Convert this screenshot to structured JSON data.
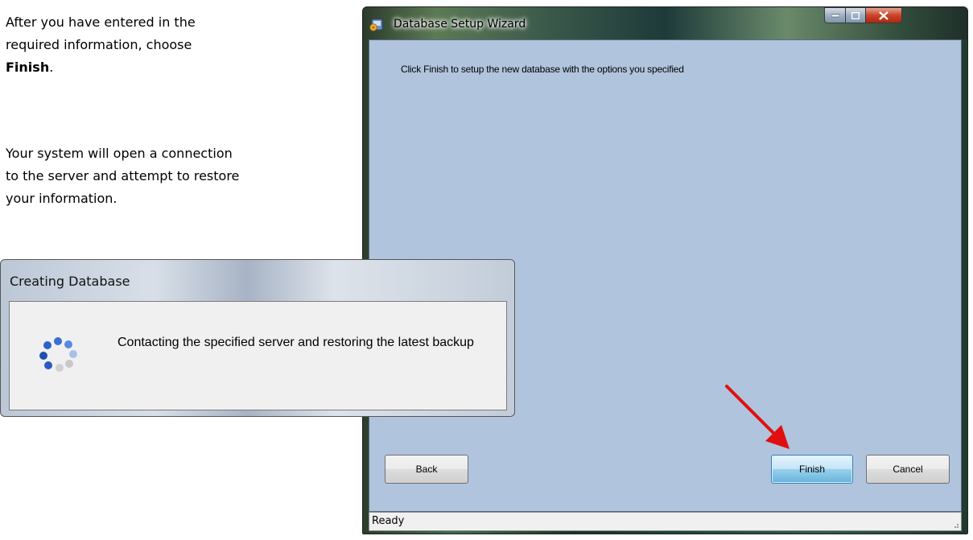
{
  "document": {
    "para1_prefix": "After you have entered in the required information, choose ",
    "para1_bold": "Finish",
    "para1_suffix": ".",
    "para2": "Your system will open a connection to the server and attempt to restore your information."
  },
  "wizard": {
    "title": "Database Setup Wizard",
    "icon": "wizard-gear-icon",
    "message": "Click Finish to setup the new database with the options you specified",
    "buttons": {
      "back": "Back",
      "finish": "Finish",
      "cancel": "Cancel"
    },
    "status": "Ready",
    "caption_buttons": {
      "minimize": "minimize-icon",
      "maximize": "maximize-icon",
      "close": "close-icon"
    }
  },
  "creating_dialog": {
    "title": "Creating Database",
    "message": "Contacting the specified server and restoring the latest backup",
    "icon": "busy-spinner-icon"
  },
  "annotation": {
    "icon": "red-arrow-icon",
    "color": "#e01010"
  },
  "colors": {
    "wizard_client": "#b0c4dd",
    "finish_accent": "#3c7fb1"
  }
}
